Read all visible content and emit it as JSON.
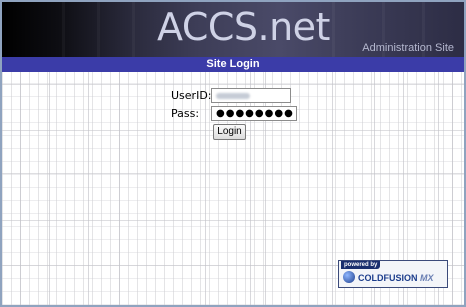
{
  "header": {
    "title": "ACCS.net",
    "subtitle": "Administration Site"
  },
  "titlebar": {
    "label": "Site Login"
  },
  "form": {
    "userid_label": "UserID:",
    "pass_label": "Pass:",
    "password_mask": "●●●●●●●●",
    "login_label": "Login"
  },
  "badge": {
    "powered": "powered by",
    "name": "COLDFUSION",
    "suffix": "MX"
  },
  "colors": {
    "titlebar": "#3b3ca8",
    "frame_border": "#8fa3bf",
    "banner_text": "#cfd2e6"
  }
}
